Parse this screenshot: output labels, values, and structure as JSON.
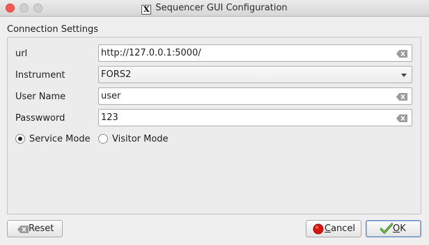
{
  "window": {
    "title": "Sequencer GUI Configuration"
  },
  "group": {
    "title": "Connection Settings"
  },
  "fields": {
    "url": {
      "label": "url",
      "value": "http://127.0.0.1:5000/"
    },
    "instrument": {
      "label": "Instrument",
      "value": "FORS2"
    },
    "username": {
      "label": "User Name",
      "value": "user"
    },
    "password": {
      "label": "Passwword",
      "value": "123"
    }
  },
  "modes": {
    "service": {
      "label": "Service Mode",
      "selected": true
    },
    "visitor": {
      "label": "Visitor Mode",
      "selected": false
    }
  },
  "buttons": {
    "reset": "Reset",
    "cancel_first": "C",
    "cancel_rest": "ancel",
    "ok_first": "O",
    "ok_rest": "K"
  },
  "icons": {
    "clear": "clear-text-icon",
    "cancel": "red-circle-icon",
    "ok": "green-checkmark-icon",
    "window": "x11-logo-icon"
  }
}
